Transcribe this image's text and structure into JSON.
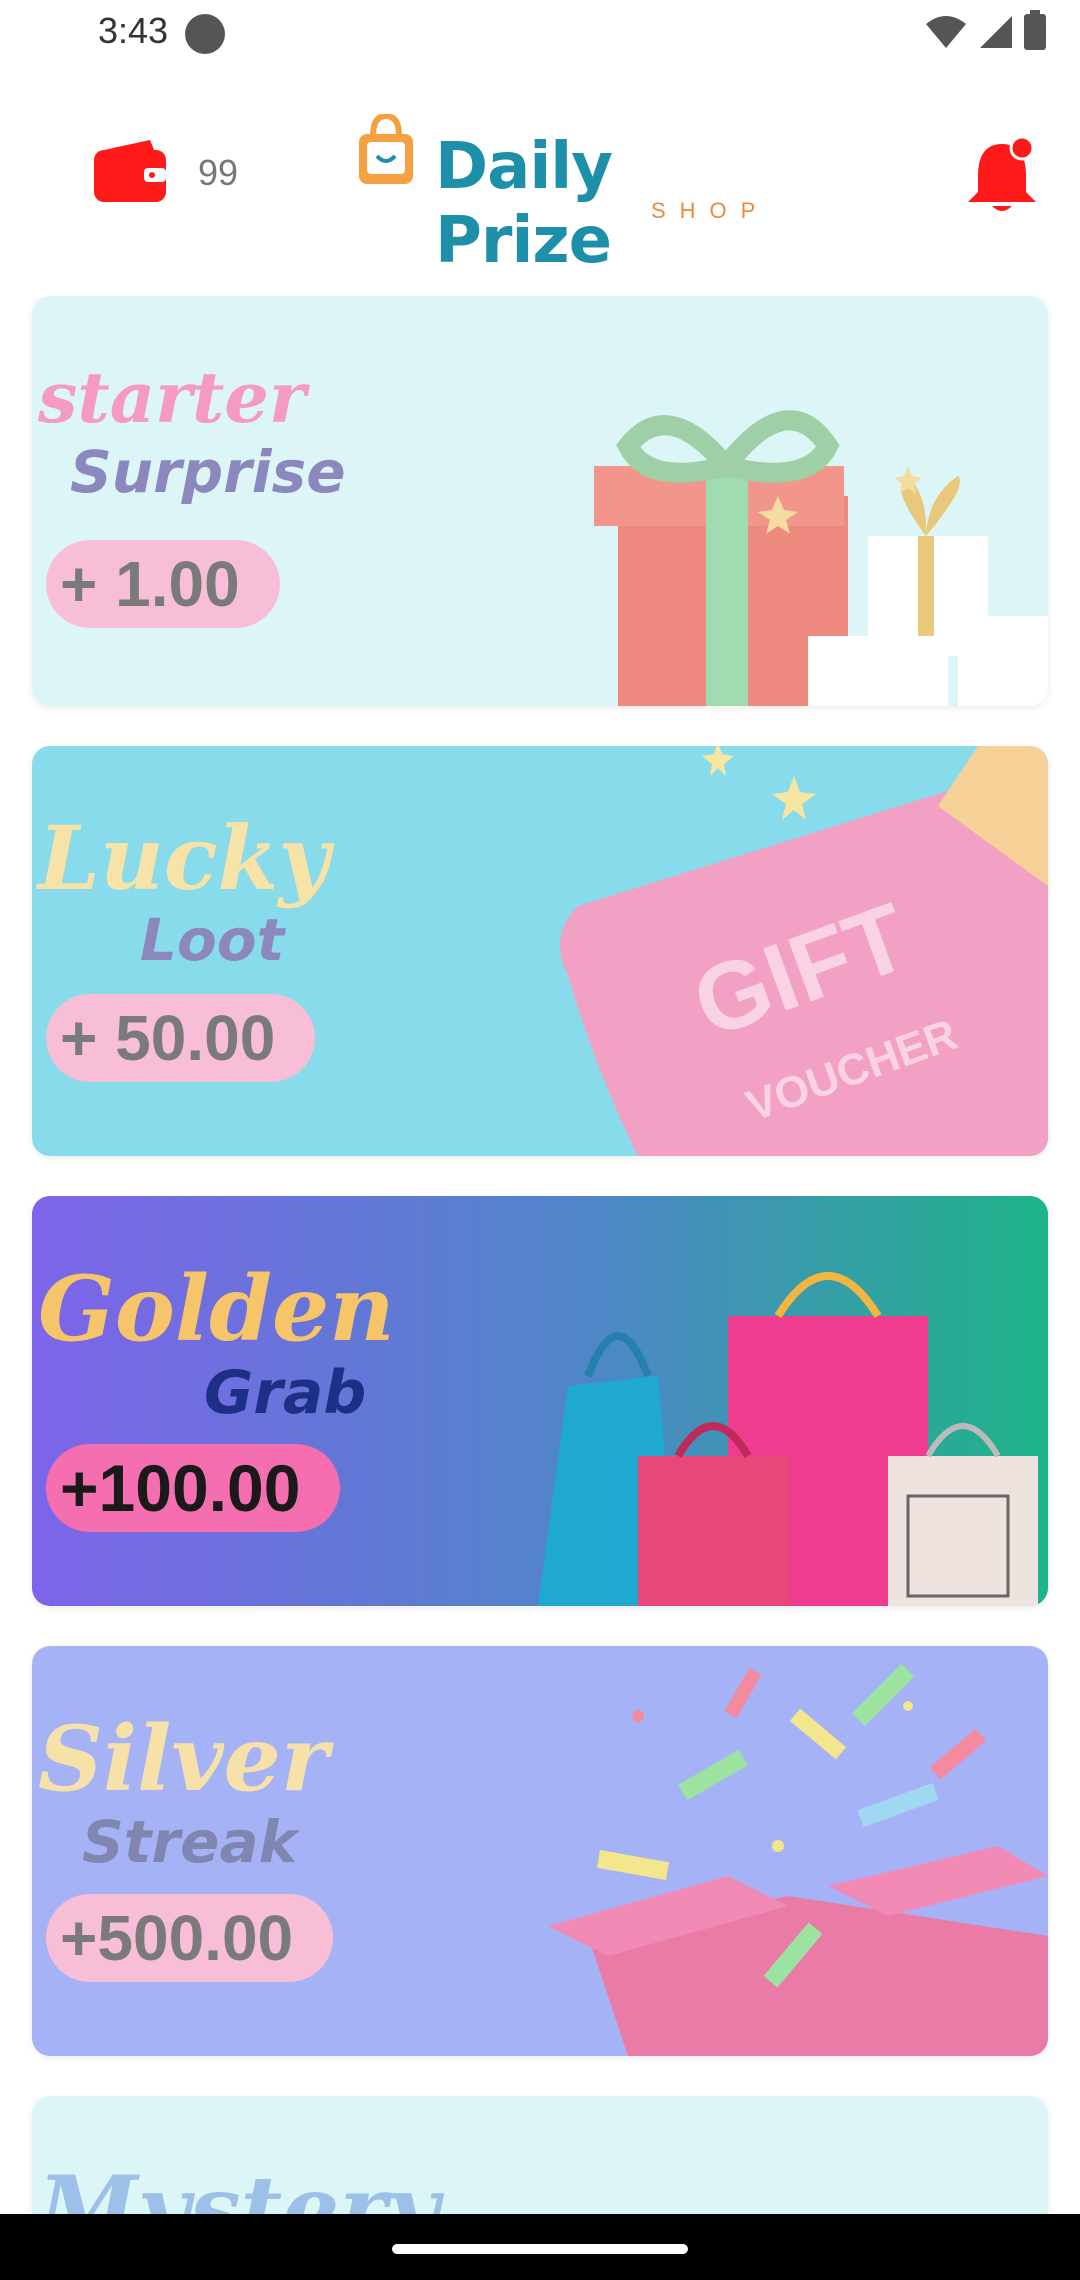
{
  "status_bar": {
    "time": "3:43"
  },
  "header": {
    "wallet_count": "99",
    "logo_title": "Daily Prize",
    "logo_subtitle": "SHOP"
  },
  "cards": [
    {
      "line1": "starter",
      "line2": "Surprise",
      "amount": "+ 1.00"
    },
    {
      "line1": "Lucky",
      "line2": "Loot",
      "amount": "+ 50.00",
      "art_text1": "GIFT",
      "art_text2": "VOUCHER"
    },
    {
      "line1": "Golden",
      "line2": "Grab",
      "amount": "+100.00"
    },
    {
      "line1": "Silver",
      "line2": "Streak",
      "amount": "+500.00"
    },
    {
      "line1": "Mystery"
    }
  ],
  "colors": {
    "accent_red": "#ff1a1a",
    "brand_teal": "#1d8fa8",
    "brand_orange": "#f08a3a"
  },
  "icons": {
    "wallet": "wallet-icon",
    "bag": "shopping-bag-icon",
    "bell": "notification-bell-icon"
  }
}
